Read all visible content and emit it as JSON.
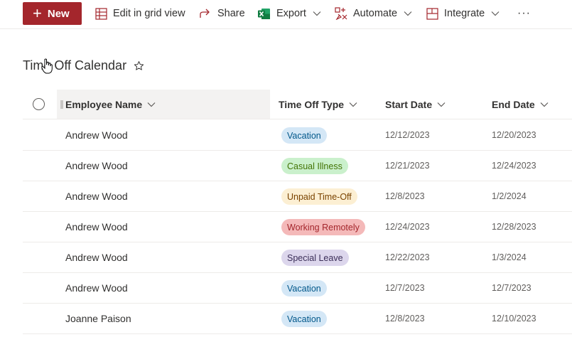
{
  "toolbar": {
    "new_label": "New",
    "edit_grid_label": "Edit in grid view",
    "share_label": "Share",
    "export_label": "Export",
    "automate_label": "Automate",
    "integrate_label": "Integrate",
    "more_label": "···"
  },
  "list": {
    "title": "Time Off Calendar"
  },
  "columns": {
    "employee_name": "Employee Name",
    "time_off_type": "Time Off Type",
    "start_date": "Start Date",
    "end_date": "End Date"
  },
  "rows": [
    {
      "employee": "Andrew Wood",
      "type": "Vacation",
      "start": "12/12/2023",
      "end": "12/20/2023"
    },
    {
      "employee": "Andrew Wood",
      "type": "Casual Illness",
      "start": "12/21/2023",
      "end": "12/24/2023"
    },
    {
      "employee": "Andrew Wood",
      "type": "Unpaid Time-Off",
      "start": "12/8/2023",
      "end": "1/2/2024"
    },
    {
      "employee": "Andrew Wood",
      "type": "Working Remotely",
      "start": "12/24/2023",
      "end": "12/28/2023"
    },
    {
      "employee": "Andrew Wood",
      "type": "Special Leave",
      "start": "12/22/2023",
      "end": "1/3/2024"
    },
    {
      "employee": "Andrew Wood",
      "type": "Vacation",
      "start": "12/7/2023",
      "end": "12/7/2023"
    },
    {
      "employee": "Joanne Paison",
      "type": "Vacation",
      "start": "12/8/2023",
      "end": "12/10/2023"
    }
  ],
  "type_colors": {
    "Vacation": {
      "bg": "#d4e7f6",
      "fg": "#00578a"
    },
    "Casual Illness": {
      "bg": "#caf0cc",
      "fg": "#437406"
    },
    "Unpaid Time-Off": {
      "bg": "#fcefd3",
      "fg": "#7a4300"
    },
    "Working Remotely": {
      "bg": "#f4b9b9",
      "fg": "#a4262c"
    },
    "Special Leave": {
      "bg": "#dcd6ec",
      "fg": "#3b2e58"
    }
  },
  "colors": {
    "accent": "#a4262c",
    "excel_green": "#107c41"
  }
}
